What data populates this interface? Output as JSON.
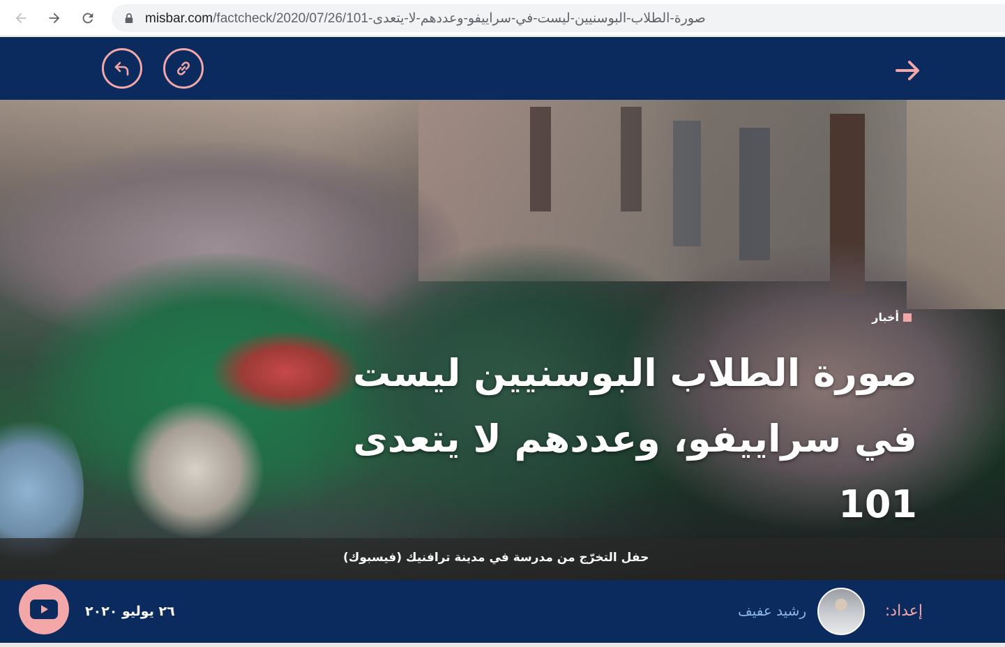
{
  "browser": {
    "url_host": "misbar.com",
    "url_path": "/factcheck/2020/07/26/101-صورة-الطلاب-البوسنيين-ليست-في-سراييفو-وعددهم-لا-يتعدى"
  },
  "site_bar": {
    "share_icon": "reply-arrow-icon",
    "link_icon": "link-icon",
    "back_icon": "arrow-right-icon"
  },
  "hero": {
    "category": "أخبار",
    "headline": "صورة الطلاب البوسنيين ليست في سراييفو، وعددهم لا يتعدى 101",
    "caption": "حفل التخرّج من مدرسة في مدينة ترافنيك (فيسبوك)"
  },
  "meta": {
    "date": "٢٦ يوليو ٢٠٢٠",
    "author_label": "إعداد:",
    "author_name": "رشيد عفيف",
    "video_icon": "youtube-play-icon"
  },
  "colors": {
    "navy": "#0b2a5e",
    "accent_pink": "#f4a7a8",
    "author_blue": "#8fb8e8"
  }
}
